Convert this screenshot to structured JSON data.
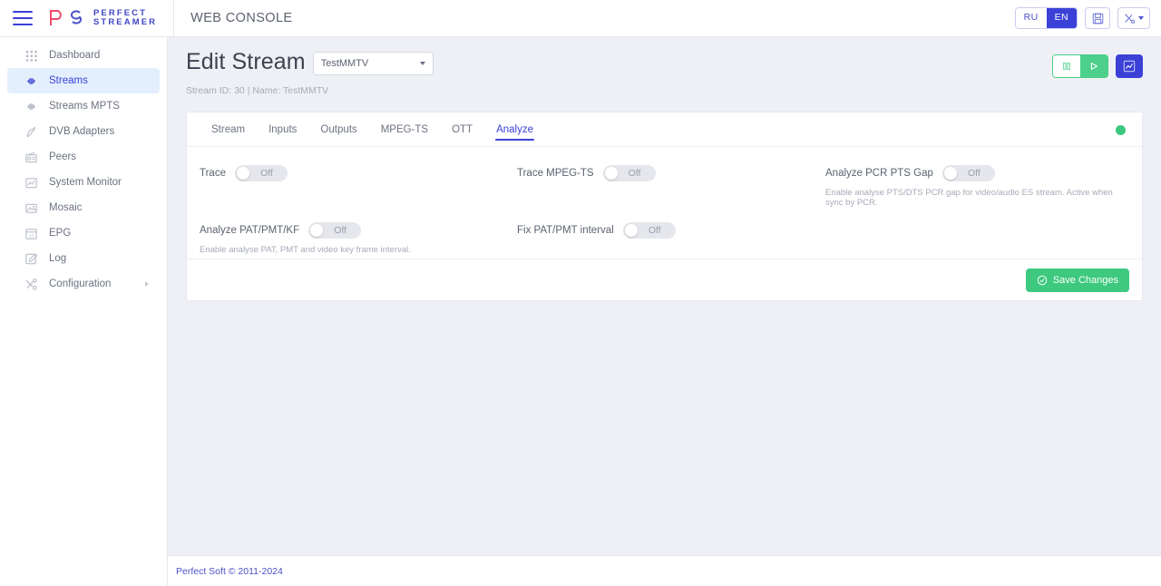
{
  "topbar": {
    "menu_icon": "hamburger-icon",
    "logo": {
      "mark": "PS",
      "line1": "PERFECT",
      "line2": "STREAMER"
    },
    "console_title": "WEB CONSOLE",
    "lang": {
      "ru": "RU",
      "en": "EN",
      "active": "EN"
    },
    "save_icon": "floppy-disk-icon",
    "tools_icon": "tools-icon"
  },
  "sidebar": {
    "items": [
      {
        "label": "Dashboard",
        "icon": "grid-dots-icon",
        "active": false,
        "chevron": false
      },
      {
        "label": "Streams",
        "icon": "streams-icon",
        "active": true,
        "chevron": false
      },
      {
        "label": "Streams MPTS",
        "icon": "streams-icon",
        "active": false,
        "chevron": false
      },
      {
        "label": "DVB Adapters",
        "icon": "satellite-icon",
        "active": false,
        "chevron": false
      },
      {
        "label": "Peers",
        "icon": "radio-icon",
        "active": false,
        "chevron": false
      },
      {
        "label": "System Monitor",
        "icon": "chart-icon",
        "active": false,
        "chevron": false
      },
      {
        "label": "Mosaic",
        "icon": "image-icon",
        "active": false,
        "chevron": false
      },
      {
        "label": "EPG",
        "icon": "calendar-icon",
        "active": false,
        "chevron": false
      },
      {
        "label": "Log",
        "icon": "pencil-note-icon",
        "active": false,
        "chevron": false
      },
      {
        "label": "Configuration",
        "icon": "wrench-icon",
        "active": false,
        "chevron": true
      }
    ]
  },
  "page": {
    "title": "Edit Stream",
    "stream_select_value": "TestMMTV",
    "subtitle": "Stream ID: 30 | Name: TestMMTV",
    "actions": {
      "pause_icon": "pause-icon",
      "play_icon": "play-icon",
      "chart_icon": "chart-line-icon"
    }
  },
  "tabs": [
    {
      "label": "Stream",
      "active": false
    },
    {
      "label": "Inputs",
      "active": false
    },
    {
      "label": "Outputs",
      "active": false
    },
    {
      "label": "MPEG-TS",
      "active": false
    },
    {
      "label": "OTT",
      "active": false
    },
    {
      "label": "Analyze",
      "active": true
    }
  ],
  "status_indicator": {
    "name": "status-dot",
    "color": "#3cc87f"
  },
  "fields": [
    {
      "label": "Trace",
      "state": "Off",
      "help": ""
    },
    {
      "label": "Trace MPEG-TS",
      "state": "Off",
      "help": ""
    },
    {
      "label": "Analyze PCR PTS Gap",
      "state": "Off",
      "help": "Enable analyse PTS/DTS PCR gap for video/audio ES stream. Active when sync by PCR."
    },
    {
      "label": "Analyze PAT/PMT/KF",
      "state": "Off",
      "help": "Enable analyse PAT, PMT and video key frame interval."
    },
    {
      "label": "Fix PAT/PMT interval",
      "state": "Off",
      "help": ""
    },
    {
      "label": "",
      "state": "",
      "help": ""
    }
  ],
  "save_button": {
    "label": "Save Changes",
    "icon": "check-circle-icon",
    "color": "#3ec97f"
  },
  "footer": {
    "text": "Perfect Soft © 2011-2024"
  }
}
